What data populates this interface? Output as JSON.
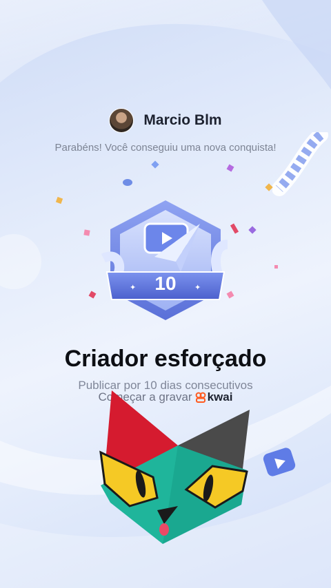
{
  "user": {
    "name": "Marcio Blm",
    "avatar_icon": "avatar-photo"
  },
  "congrats_text": "Parabéns! Você conseguiu uma nova conquista!",
  "badge": {
    "number": "10",
    "icon": "video-paper-plane-badge"
  },
  "achievement": {
    "title": "Criador esforçado",
    "description": "Publicar por 10 dias consecutivos"
  },
  "cta": {
    "label": "Começar a gravar",
    "brand": "kwai"
  },
  "colors": {
    "badge_primary": "#6f86e8",
    "badge_dark": "#4e63c9",
    "kwai_orange": "#ff5a1f",
    "cat_teal": "#1fb59b",
    "cat_red": "#d51b2f",
    "cat_gray": "#4a4a4a",
    "cat_yellow": "#f5c925"
  }
}
